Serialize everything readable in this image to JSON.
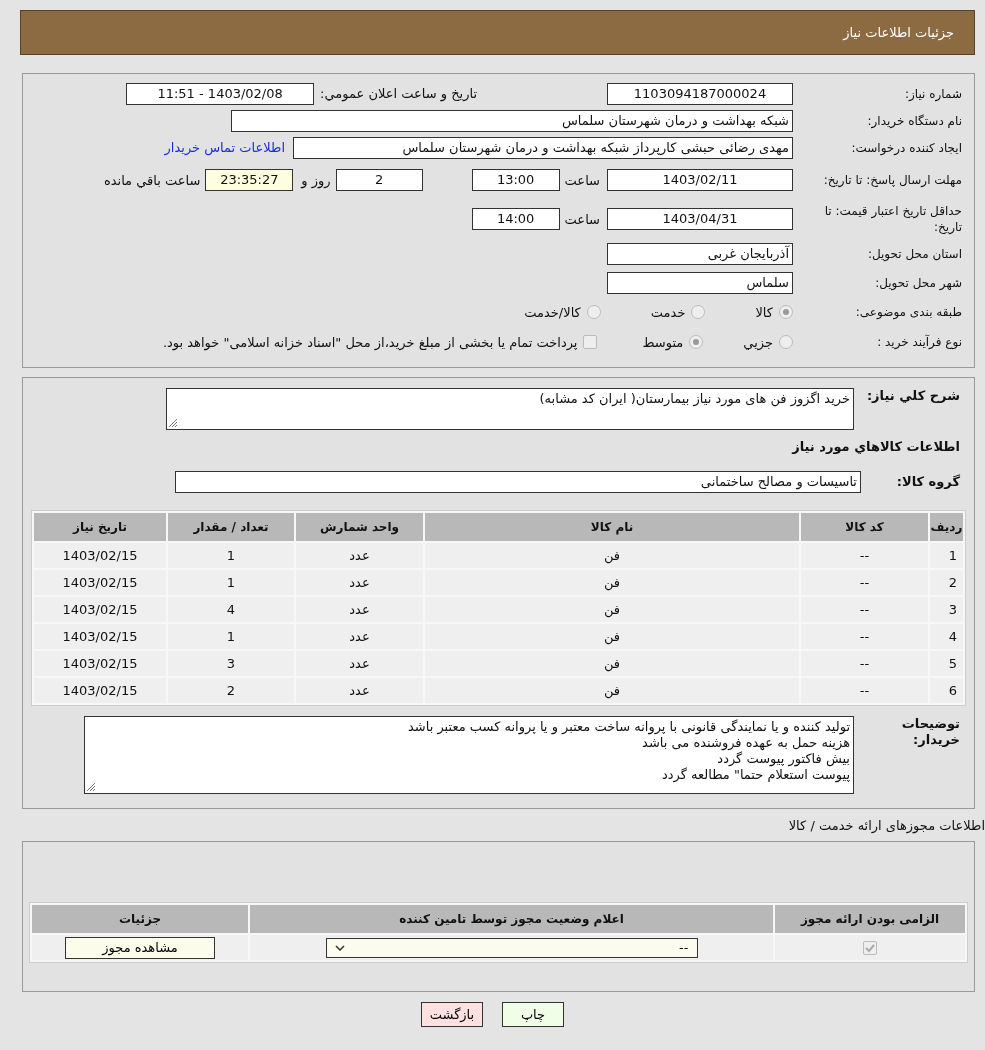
{
  "header": {
    "title": "جزئیات اطلاعات نیاز"
  },
  "info": {
    "need_number": {
      "label": "شماره نیاز:",
      "value": "1103094187000024"
    },
    "announce": {
      "label": "تاریخ و ساعت اعلان عمومي:",
      "value": "1403/02/08 - 11:51"
    },
    "buyer": {
      "label": "نام دستگاه خریدار:",
      "value": "شبکه بهداشت و درمان  شهرستان سلماس"
    },
    "creator": {
      "label": "ایجاد کننده درخواست:",
      "value": "مهدی رضائی حبشی کارپرداز شبکه بهداشت و درمان  شهرستان سلماس",
      "link": "اطلاعات تماس خریدار"
    },
    "reply_deadline": {
      "label": "مهلت ارسال پاسخ: تا تاریخ:",
      "date": "1403/02/11",
      "time_label": "ساعت",
      "time": "13:00",
      "days": "2",
      "days_label": "روز و",
      "remaining": "23:35:27",
      "remaining_label": "ساعت باقي مانده"
    },
    "price_validity": {
      "label": "حداقل تاریخ اعتبار قیمت: تا تاریخ:",
      "date": "1403/04/31",
      "time_label": "ساعت",
      "time": "14:00"
    },
    "province": {
      "label": "استان محل تحویل:",
      "value": "آذربایجان غربی"
    },
    "city": {
      "label": "شهر محل تحویل:",
      "value": "سلماس"
    },
    "category": {
      "label": "طبقه بندی موضوعی:",
      "options": [
        {
          "label": "کالا",
          "selected": true
        },
        {
          "label": "خدمت",
          "selected": false
        },
        {
          "label": "کالا/خدمت",
          "selected": false
        }
      ]
    },
    "process": {
      "label": "نوع فرآیند خرید :",
      "options": [
        {
          "label": "جزيي",
          "selected": false
        },
        {
          "label": "متوسط",
          "selected": true
        }
      ],
      "treasury": {
        "checked": false,
        "label": "پرداخت تمام یا بخشی از مبلغ خرید،از محل \"اسناد خزانه اسلامی\" خواهد بود."
      }
    }
  },
  "needs": {
    "summary": {
      "label": "شرح کلي نیاز:",
      "value": "خرید اگزوز فن های مورد نیاز بیمارستان( ایران کد مشابه)"
    },
    "goods_title": "اطلاعات کالاهاي مورد نیاز",
    "group": {
      "label": "گروه کالا:",
      "value": "تاسیسات و مصالح ساختمانی"
    },
    "table": {
      "columns": [
        "ردیف",
        "کد کالا",
        "نام کالا",
        "واحد شمارش",
        "تعداد / مقدار",
        "تاریخ نیاز"
      ],
      "rows": [
        [
          "1",
          "--",
          "فن",
          "عدد",
          "1",
          "1403/02/15"
        ],
        [
          "2",
          "--",
          "فن",
          "عدد",
          "1",
          "1403/02/15"
        ],
        [
          "3",
          "--",
          "فن",
          "عدد",
          "4",
          "1403/02/15"
        ],
        [
          "4",
          "--",
          "فن",
          "عدد",
          "1",
          "1403/02/15"
        ],
        [
          "5",
          "--",
          "فن",
          "عدد",
          "3",
          "1403/02/15"
        ],
        [
          "6",
          "--",
          "فن",
          "عدد",
          "2",
          "1403/02/15"
        ]
      ]
    },
    "notes": {
      "label": "توضیحات خریدار:",
      "lines": [
        "تولید کننده و یا نمایندگی قانونی با پروانه ساخت معتبر و یا پروانه کسب معتبر باشد",
        "هزینه حمل به عهده فروشنده می باشد",
        "بیش فاکتور پیوست گردد",
        "پیوست استعلام حتما\" مطالعه گردد"
      ]
    }
  },
  "licenses": {
    "title": "اطلاعات مجوزهای ارائه خدمت / کالا",
    "columns": [
      "الزامی بودن ارائه مجوز",
      "اعلام وضعیت مجوز توسط تامین کننده",
      "جزئیات"
    ],
    "rows": [
      {
        "required": true,
        "status": "--",
        "action": "مشاهده مجوز"
      }
    ]
  },
  "actions": [
    {
      "label": "چاپ",
      "kind": "print"
    },
    {
      "label": "بازگشت",
      "kind": "back"
    }
  ]
}
